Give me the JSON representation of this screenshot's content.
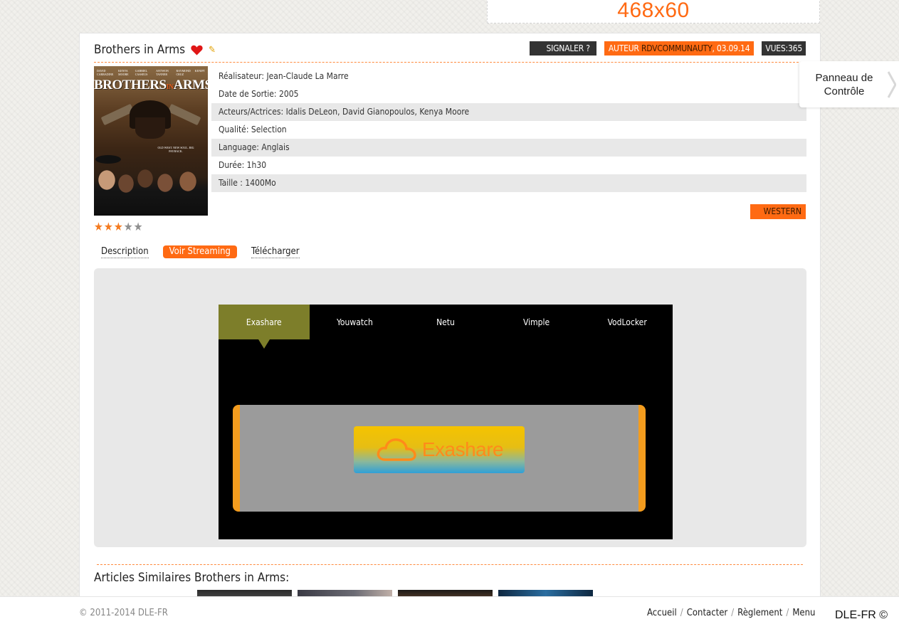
{
  "banner": {
    "text": "468x60"
  },
  "article": {
    "title": "Brothers in Arms",
    "badges": {
      "report": "SIGNALER ?",
      "author_prefix": "AUTEUR ",
      "author": "RDVCOMMUNAUTY",
      "date": ", 03.09.14",
      "views": "VUES:365"
    },
    "poster": {
      "title_part1": "BROTHERS",
      "title_part2": "IN",
      "title_part3": "ARMS",
      "cast": [
        "DAVID CARRADINE",
        "KENYA MOORE",
        "GABRIEL CASSEUS",
        "ANTWON TANNER",
        "RAYMOND CRUZ",
        "KENIPT"
      ],
      "tagline": "OLD WEST. NEW SOUL. BIG PAYBACK."
    },
    "info": [
      "Réalisateur: Jean-Claude La Marre",
      "Date de Sortie: 2005",
      "Acteurs/Actrices: Idalis DeLeon, David Gianopoulos, Kenya Moore",
      "Qualité: Selection",
      "Language: Anglais",
      "Durée: 1h30",
      "Taille : 1400Mo"
    ],
    "genre": "WESTERN",
    "rating": {
      "value": 3,
      "max": 5
    }
  },
  "tabs": [
    {
      "label": "Description",
      "active": false
    },
    {
      "label": "Voir Streaming",
      "active": true
    },
    {
      "label": "Télécharger",
      "active": false
    }
  ],
  "player": {
    "hosts": [
      "Exashare",
      "Youwatch",
      "Netu",
      "Vimple",
      "VodLocker"
    ],
    "active_host": "Exashare",
    "embed_logo_text": "Exashare"
  },
  "similar": {
    "title": "Articles Similaires Brothers in Arms:"
  },
  "panel": {
    "label": "Panneau de Contrôle"
  },
  "footer": {
    "copyright": "© 2011-2014 DLE-FR",
    "links": [
      "Accueil",
      "Contacter",
      "Règlement",
      "Menu"
    ],
    "separator": "/",
    "brand": "DLE-FR ©"
  },
  "colors": {
    "accent": "#ff6a13",
    "active_host": "#7d7e2a",
    "dark_badge": "#333333"
  }
}
